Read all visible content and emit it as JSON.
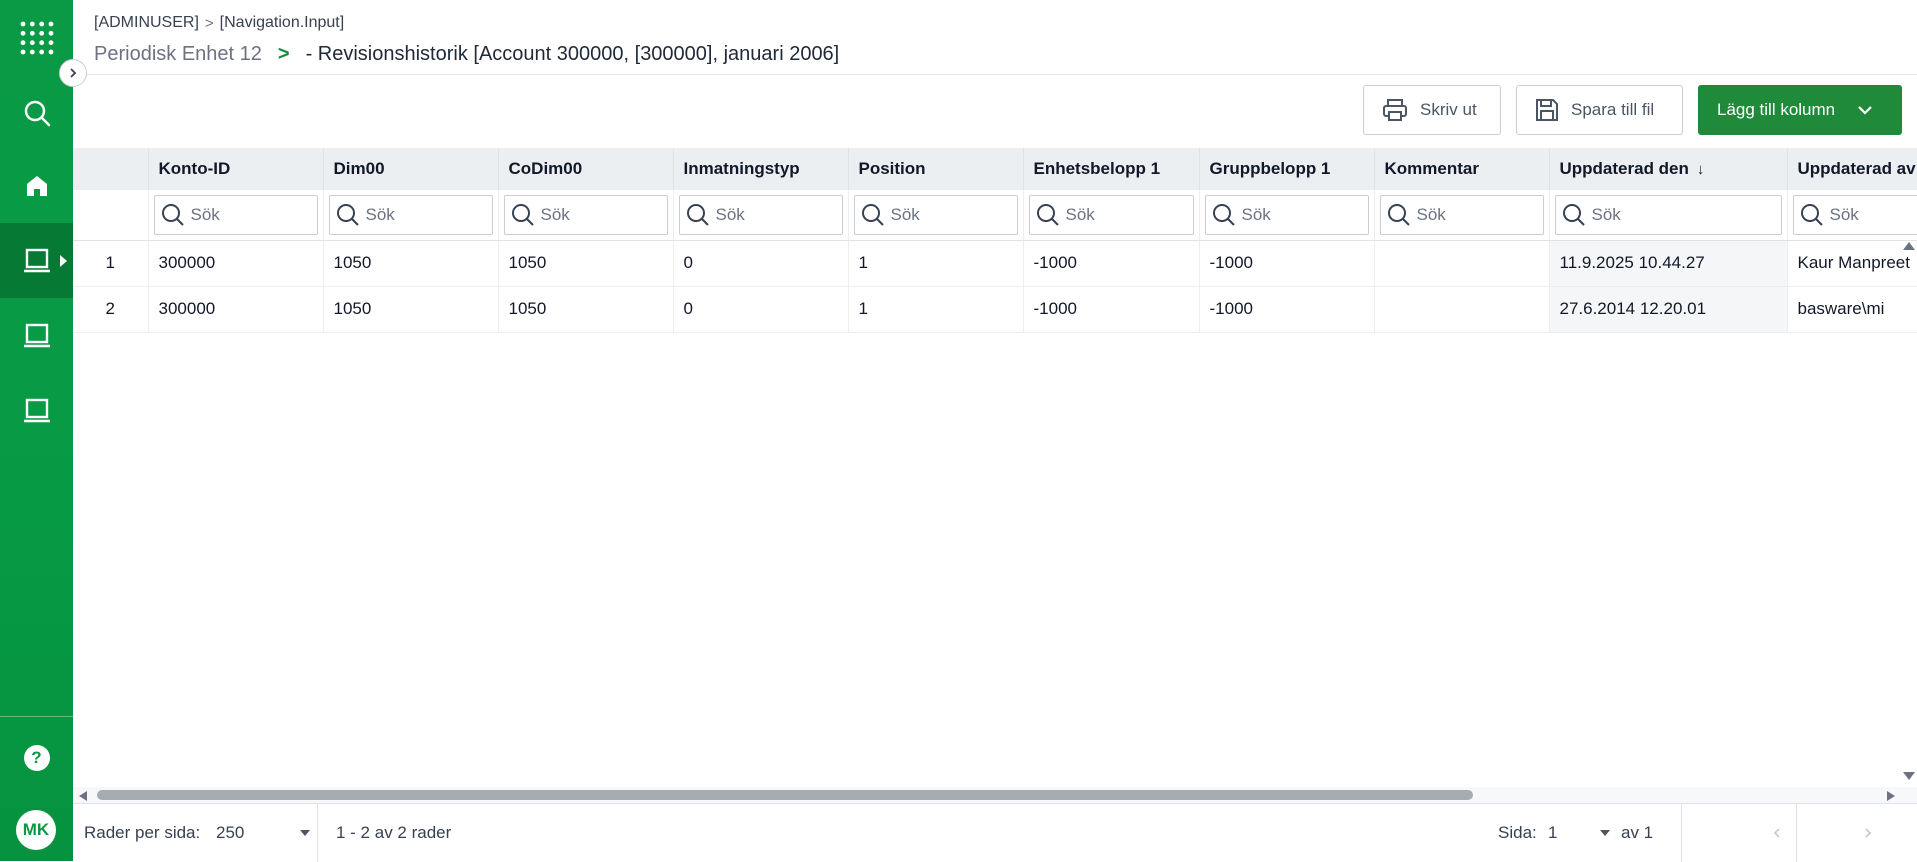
{
  "breadcrumb": {
    "user": "[ADMINUSER]",
    "separator": ">",
    "page": "[Navigation.Input]"
  },
  "title": {
    "parent": "Periodisk Enhet 12",
    "gt": ">",
    "main": "- Revisionshistorik [Account 300000, [300000], januari 2006]"
  },
  "sidebar": {
    "avatar_initials": "MK",
    "help_symbol": "?"
  },
  "toolbar": {
    "print_label": "Skriv ut",
    "save_label": "Spara till fil",
    "add_column_label": "Lägg till kolumn"
  },
  "grid": {
    "columns": [
      "Konto-ID",
      "Dim00",
      "CoDim00",
      "Inmatningstyp",
      "Position",
      "Enhetsbelopp 1",
      "Gruppbelopp 1",
      "Kommentar",
      "Uppdaterad den",
      "Uppdaterad av"
    ],
    "sort_indicator": "↓",
    "search_placeholder": "Sök",
    "rows": [
      {
        "num": "1",
        "cells": [
          "300000",
          "1050",
          "1050",
          "0",
          "1",
          "-1000",
          "-1000",
          "",
          "11.9.2025 10.44.27",
          "Kaur Manpreet"
        ]
      },
      {
        "num": "2",
        "cells": [
          "300000",
          "1050",
          "1050",
          "0",
          "1",
          "-1000",
          "-1000",
          "",
          "27.6.2014 12.20.01",
          "basware\\mi"
        ]
      }
    ]
  },
  "footer": {
    "rows_per_page_label": "Rader per sida:",
    "rows_per_page_value": "250",
    "range_text": "1 - 2 av 2 rader",
    "page_label": "Sida:",
    "page_value": "1",
    "page_total": "av 1"
  },
  "colors": {
    "brand_green": "#079a44",
    "button_green": "#1f8a3a",
    "header_bg": "#eceff2"
  }
}
